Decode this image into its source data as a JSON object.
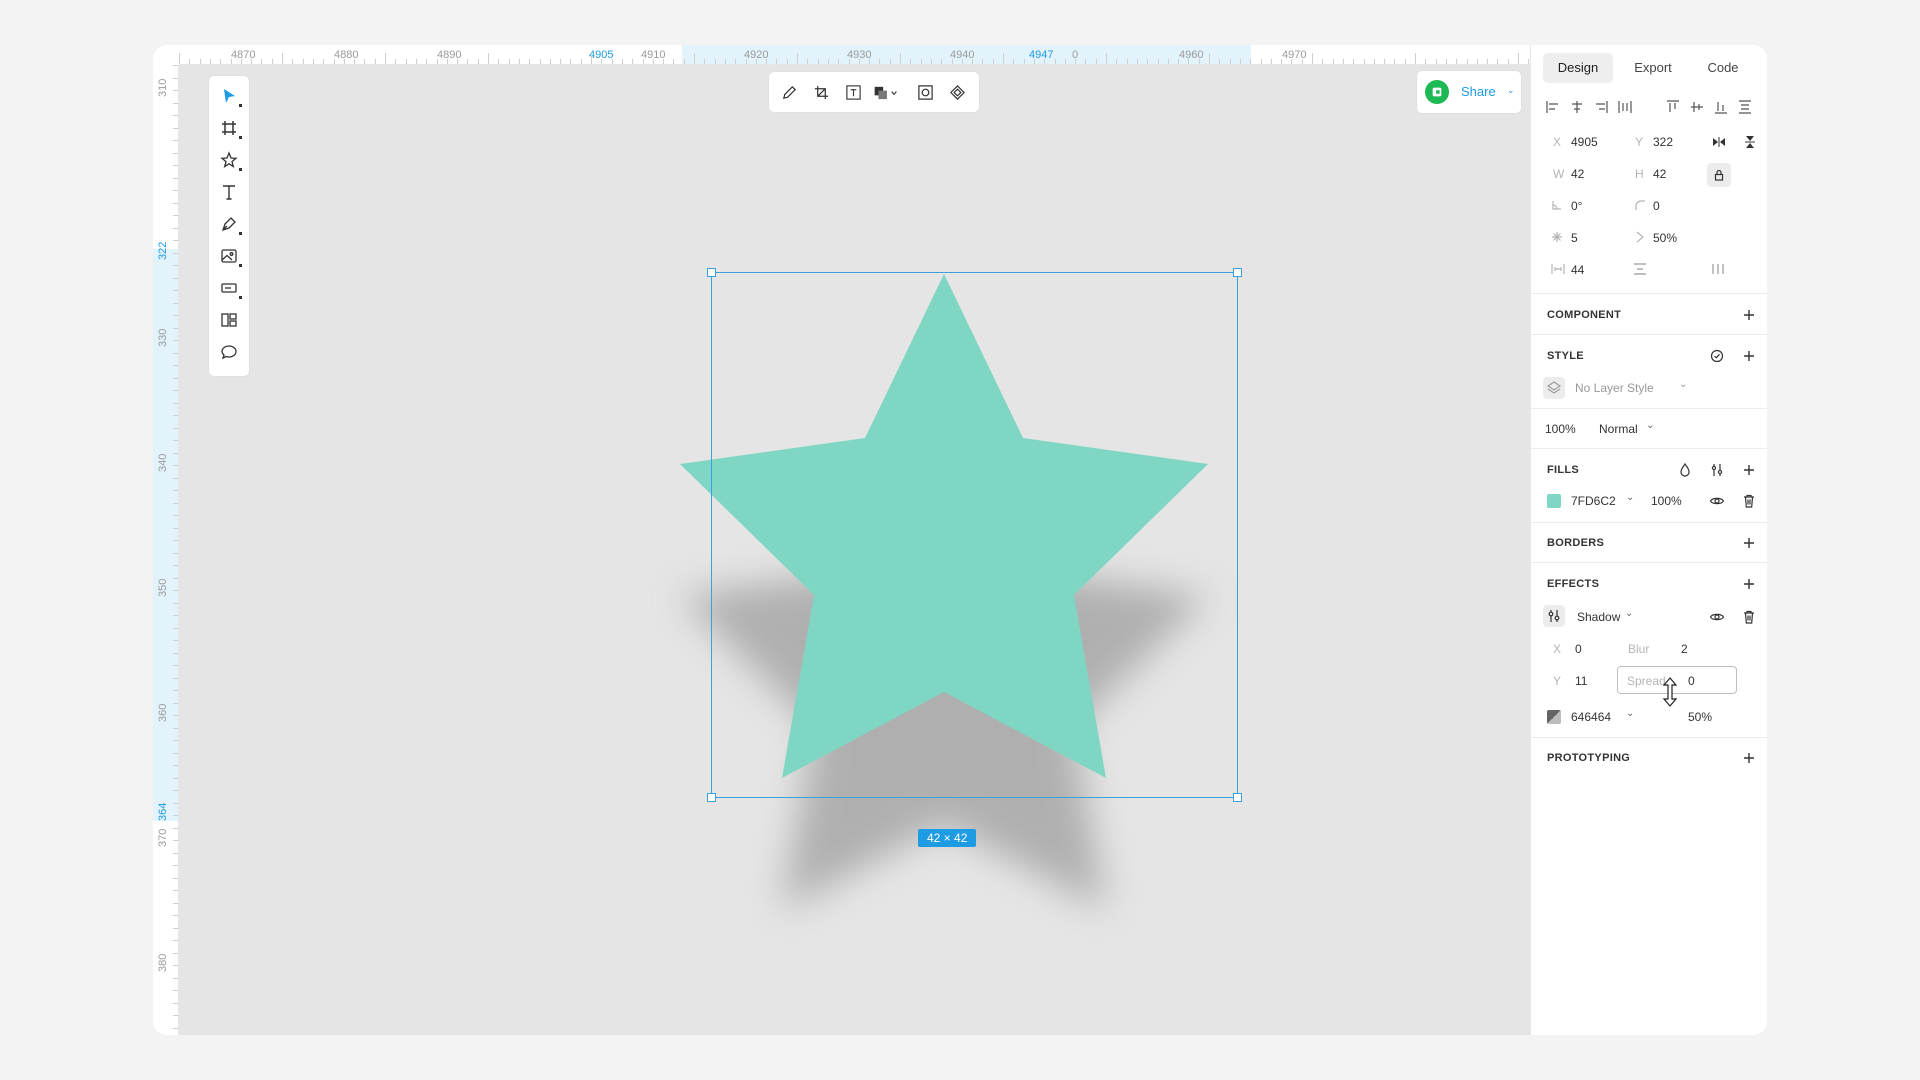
{
  "ruler": {
    "h_labels": [
      "4870",
      "4880",
      "4890",
      "4905",
      "4910",
      "4920",
      "4930",
      "4940",
      "4947",
      "0",
      "4960",
      "4970"
    ],
    "v_labels": [
      "310",
      "322",
      "330",
      "340",
      "350",
      "360",
      "364",
      "370",
      "380"
    ]
  },
  "share": {
    "label": "Share"
  },
  "selection": {
    "size_label": "42 × 42"
  },
  "tabs": [
    "Design",
    "Export",
    "Code"
  ],
  "props": {
    "x_label": "X",
    "x": "4905",
    "y_label": "Y",
    "y": "322",
    "w_label": "W",
    "w": "42",
    "h_label": "H",
    "h": "42",
    "rotation": "0°",
    "radius": "0",
    "points": "5",
    "ratio": "50%",
    "spacing": "44"
  },
  "sections": {
    "component": "COMPONENT",
    "style": "STYLE",
    "fills": "FILLS",
    "borders": "BORDERS",
    "effects": "EFFECTS",
    "prototyping": "PROTOTYPING"
  },
  "style": {
    "layer_style": "No Layer Style",
    "opacity": "100%",
    "blend": "Normal"
  },
  "fill": {
    "color_hex": "7FD6C2",
    "color": "#7FD6C2",
    "opacity": "100%"
  },
  "effect": {
    "type": "Shadow",
    "x_label": "X",
    "x": "0",
    "blur_label": "Blur",
    "blur": "2",
    "y_label": "Y",
    "y": "11",
    "spread_placeholder": "Spread",
    "spread": "0",
    "color_hex": "646464",
    "color": "#646464",
    "opacity": "50%"
  },
  "colors": {
    "accent": "#1d9be3",
    "canvas": "#e5e5e5",
    "star": "#7FD6C2",
    "share_avatar": "#1db954"
  }
}
